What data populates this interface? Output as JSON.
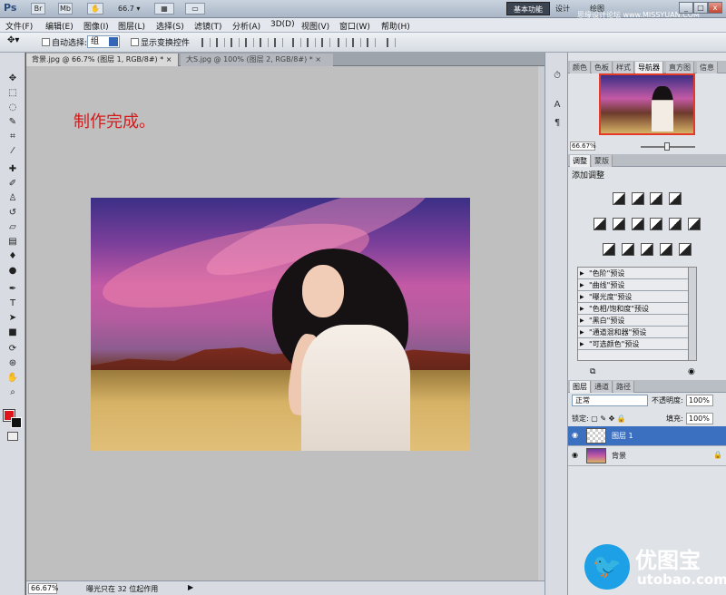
{
  "titlebar": {
    "app_logo": "Ps",
    "zoom": "66.7",
    "zoom_arrow": "▾",
    "br_label": "Br",
    "mb_label": "Mb",
    "workspace_active": "基本功能",
    "workspace_design": "设计",
    "workspace_paint": "绘图",
    "watermark": "思缘设计论坛 www.MISSYUAN.COM",
    "win_min": "_",
    "win_max": "□",
    "win_close": "x"
  },
  "menu": [
    "文件(F)",
    "编辑(E)",
    "图像(I)",
    "图层(L)",
    "选择(S)",
    "滤镜(T)",
    "分析(A)",
    "3D(D)",
    "视图(V)",
    "窗口(W)",
    "帮助(H)"
  ],
  "options": {
    "auto_select_label": "自动选择:",
    "group_value": "组",
    "show_transform_label": "显示变换控件"
  },
  "document": {
    "tab_active": "背景.jpg @ 66.7% (图层 1, RGB/8#) *",
    "tab_close": "×",
    "tab_other": "大S.jpg @ 100% (图层 2, RGB/8#) *",
    "caption": "制作完成。",
    "status_zoom": "66.67%",
    "status_text": "曝光只在 32 位起作用",
    "status_arrow": "▶"
  },
  "panels": {
    "top_tabs": [
      "颜色",
      "色板",
      "样式",
      "导航器",
      "直方图",
      "信息"
    ],
    "top_active": "导航器",
    "nav_zoom": "66.67%",
    "adj_tabs": [
      "调整",
      "蒙版"
    ],
    "adj_title": "添加调整",
    "presets": [
      "\"色阶\"预设",
      "\"曲线\"预设",
      "\"曝光度\"预设",
      "\"色相/饱和度\"预设",
      "\"黑白\"预设",
      "\"通道混和器\"预设",
      "\"可选颜色\"预设"
    ],
    "layer_tabs": [
      "图层",
      "通道",
      "路径"
    ],
    "blend_mode": "正常",
    "opacity_label": "不透明度:",
    "opacity": "100%",
    "lock_label": "锁定:",
    "fill_label": "填充:",
    "fill": "100%",
    "layers": [
      "图层 1",
      "背景"
    ]
  },
  "brand": {
    "name": "优图宝",
    "url": "utobao.com"
  },
  "colors": {
    "foreground": "#e0151b",
    "background": "#111111",
    "caption": "#d31b1b"
  }
}
